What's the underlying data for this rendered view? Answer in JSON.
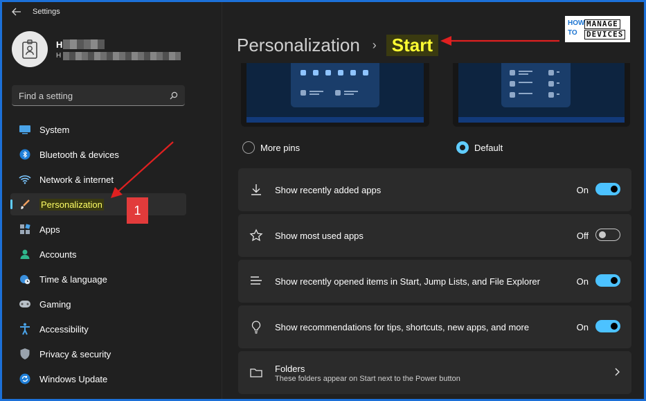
{
  "window": {
    "title": "Settings"
  },
  "user": {
    "name": "H",
    "email": "H"
  },
  "search": {
    "placeholder": "Find a setting"
  },
  "sidebar": {
    "items": [
      {
        "label": "System",
        "icon": "monitor-icon"
      },
      {
        "label": "Bluetooth & devices",
        "icon": "bluetooth-icon"
      },
      {
        "label": "Network & internet",
        "icon": "wifi-icon"
      },
      {
        "label": "Personalization",
        "icon": "brush-icon",
        "selected": true
      },
      {
        "label": "Apps",
        "icon": "apps-icon"
      },
      {
        "label": "Accounts",
        "icon": "person-icon"
      },
      {
        "label": "Time & language",
        "icon": "globe-clock-icon"
      },
      {
        "label": "Gaming",
        "icon": "gamepad-icon"
      },
      {
        "label": "Accessibility",
        "icon": "accessibility-icon"
      },
      {
        "label": "Privacy & security",
        "icon": "shield-icon"
      },
      {
        "label": "Windows Update",
        "icon": "update-icon"
      }
    ]
  },
  "annotation": {
    "badge": "1"
  },
  "breadcrumb": {
    "parent": "Personalization",
    "separator": "›",
    "current": "Start"
  },
  "logo": {
    "how": "HOW",
    "to": "TO",
    "manage": "MANAGE",
    "devices": "DEVICES"
  },
  "layout_options": [
    {
      "label": "More pins",
      "selected": false
    },
    {
      "label": "Default",
      "selected": true
    }
  ],
  "settings": [
    {
      "label": "Show recently added apps",
      "state": "On",
      "on": true,
      "icon": "download-icon"
    },
    {
      "label": "Show most used apps",
      "state": "Off",
      "on": false,
      "icon": "star-icon"
    },
    {
      "label": "Show recently opened items in Start, Jump Lists, and File Explorer",
      "state": "On",
      "on": true,
      "icon": "list-icon"
    },
    {
      "label": "Show recommendations for tips, shortcuts, new apps, and more",
      "state": "On",
      "on": true,
      "icon": "lightbulb-icon"
    }
  ],
  "folders": {
    "title": "Folders",
    "description": "These folders appear on Start next to the Power button"
  },
  "colors": {
    "accent": "#60cdff",
    "toggle_on": "#4cc2ff",
    "highlight_text": "#ffff33",
    "badge": "#e23b3b",
    "arrow": "#e02020"
  }
}
